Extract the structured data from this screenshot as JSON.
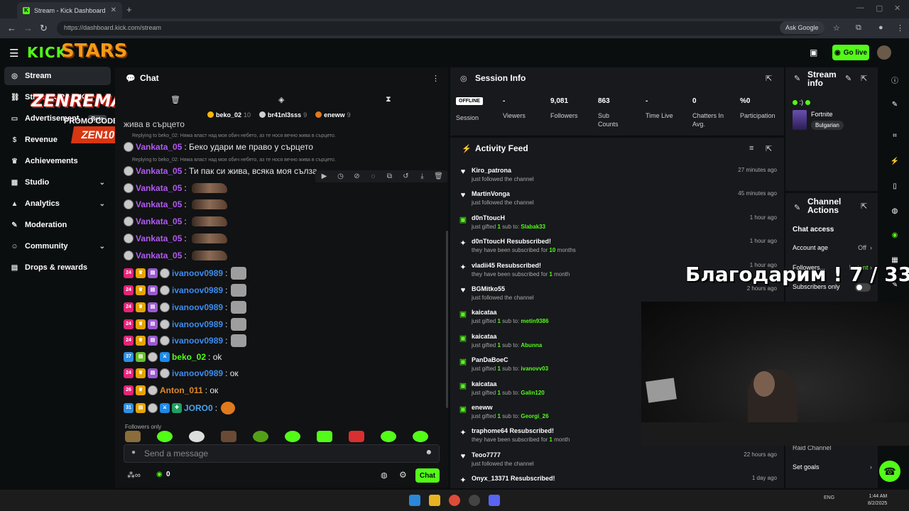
{
  "browser": {
    "tab_title": "Stream - Kick Dashboard",
    "url": "https://dashboard.kick.com/stream",
    "ask_google": "Ask Google"
  },
  "app": {
    "logo": "KICK",
    "overlay_brand": "STARS",
    "go_live": "Go live"
  },
  "overlay": {
    "streamer": "ZENREMASTA",
    "promo_label": "PROMO CODE",
    "promo_code": "ZEN10",
    "thanks_text": "Благодарим ! 7 / 33"
  },
  "sidebar": {
    "items": [
      {
        "label": "Stream",
        "icon": "broadcast-icon",
        "active": true
      },
      {
        "label": "Stream URL & Key",
        "icon": "link-icon"
      },
      {
        "label": "Advertisement",
        "icon": "ad-icon",
        "badge": "Beta"
      },
      {
        "label": "Revenue",
        "icon": "dollar-icon"
      },
      {
        "label": "Achievements",
        "icon": "trophy-icon"
      },
      {
        "label": "Studio",
        "icon": "studio-icon",
        "expandable": true
      },
      {
        "label": "Analytics",
        "icon": "analytics-icon",
        "expandable": true
      },
      {
        "label": "Moderation",
        "icon": "wrench-icon"
      },
      {
        "label": "Community",
        "icon": "community-icon",
        "expandable": true
      },
      {
        "label": "Drops & rewards",
        "icon": "drops-icon"
      }
    ]
  },
  "chat": {
    "title": "Chat",
    "pinned": [
      {
        "name": "beko_02",
        "count": "10",
        "color": "#f5b70b"
      },
      {
        "name": "br41nl3sss",
        "count": "9",
        "color": "#cfcfcf"
      },
      {
        "name": "eneww",
        "count": "9",
        "color": "#e07b1d"
      }
    ],
    "top_partial": "жива в сърцето",
    "reply1": "Replying to beko_02: Няма власт над моя обич небето, аз те нося вечно жива в сърцето.",
    "msg1_user": "Vankata_05",
    "msg1_text": ": Беко удари ме право у сърцето",
    "reply2": "Replying to beko_02: Няма власт над моя обич небето, аз те нося вечно жива в сърцето.",
    "msg2_user": "Vankata_05",
    "msg2_text": ": Ти пак си жива, всяка моя сълза",
    "vankata_user": "Vankata_05",
    "ivanoov_user": "ivanoov0989",
    "beko_user": "beko_02",
    "beko_text": ": ok",
    "ivanoov_ok_text": ": ок",
    "anton_user": "Anton_011",
    "anton_text": ": ок",
    "joro_user": "JORO0",
    "followers_only": "Followers only",
    "input_placeholder": "Send a message",
    "points": "0",
    "send_label": "Chat"
  },
  "session": {
    "title": "Session Info",
    "status": "OFFLINE",
    "status_label": "Session",
    "stats": [
      {
        "value": "-",
        "label": "Viewers"
      },
      {
        "value": "9,081",
        "label": "Followers"
      },
      {
        "value": "863",
        "label": "Sub Counts"
      },
      {
        "value": "-",
        "label": "Time Live"
      },
      {
        "value": "0",
        "label": "Chatters In Avg."
      },
      {
        "value": "%0",
        "label": "Participation"
      }
    ]
  },
  "activity": {
    "title": "Activity Feed",
    "items": [
      {
        "icon": "heart-icon",
        "name": "Kiro_patrona",
        "desc": "just followed the channel",
        "time": "27 minutes ago"
      },
      {
        "icon": "heart-icon",
        "name": "MartinVonga",
        "desc": "just followed the channel",
        "time": "45 minutes ago"
      },
      {
        "icon": "gift-icon",
        "name": "d0nTtoucH",
        "desc_pre": "just gifted ",
        "desc_num": "1",
        "desc_mid": " sub to: ",
        "desc_target": "Slabak33",
        "time": "1 hour ago"
      },
      {
        "icon": "sparkle-icon",
        "name": "d0nTtoucH Resubscribed!",
        "desc_pre": "they have been subscribed for ",
        "desc_num": "10",
        "desc_mid": " months",
        "desc_target": "",
        "time": "1 hour ago"
      },
      {
        "icon": "sparkle-icon",
        "name": "vladii45 Resubscribed!",
        "desc_pre": "they have been subscribed for ",
        "desc_num": "1",
        "desc_mid": " month",
        "desc_target": "",
        "time": "1 hour ago"
      },
      {
        "icon": "heart-icon",
        "name": "BGMitko55",
        "desc": "just followed the channel",
        "time": "2 hours ago"
      },
      {
        "icon": "gift-icon",
        "name": "kaicataa",
        "desc_pre": "just gifted ",
        "desc_num": "1",
        "desc_mid": " sub to: ",
        "desc_target": "metin9386",
        "time": ""
      },
      {
        "icon": "gift-icon",
        "name": "kaicataa",
        "desc_pre": "just gifted ",
        "desc_num": "1",
        "desc_mid": " sub to: ",
        "desc_target": "Abunna",
        "time": ""
      },
      {
        "icon": "gift-icon",
        "name": "PanDaBoeC",
        "desc_pre": "just gifted ",
        "desc_num": "1",
        "desc_mid": " sub to: ",
        "desc_target": "ivanovv03",
        "time": ""
      },
      {
        "icon": "gift-icon",
        "name": "kaicataa",
        "desc_pre": "just gifted ",
        "desc_num": "1",
        "desc_mid": " sub to: ",
        "desc_target": "Galin120",
        "time": ""
      },
      {
        "icon": "gift-icon",
        "name": "eneww",
        "desc_pre": "just gifted ",
        "desc_num": "1",
        "desc_mid": " sub to: ",
        "desc_target": "Georgi_26",
        "time": ""
      },
      {
        "icon": "sparkle-icon",
        "name": "traphome64 Resubscribed!",
        "desc_pre": "they have been subscribed for ",
        "desc_num": "1",
        "desc_mid": " month",
        "desc_target": "",
        "time": ""
      },
      {
        "icon": "heart-icon",
        "name": "Teoo7777",
        "desc": "just followed the channel",
        "time": "22 hours ago"
      },
      {
        "icon": "sparkle-icon",
        "name": "Onyx_13371 Resubscribed!",
        "desc": "",
        "time": "1 day ago"
      }
    ]
  },
  "stream_info": {
    "title": "Stream info",
    "status_text": ":)",
    "category": "Fortnite",
    "language": "Bulgarian"
  },
  "channel_actions": {
    "title": "Channel Actions",
    "chat_access": "Chat access",
    "account_age": "Account age",
    "account_age_value": "Off",
    "followers": "Followers...",
    "followers_value": "Instant",
    "subscribers_only": "Subscribers only",
    "raid_channel": "Raid Channel",
    "set_goals": "Set goals"
  },
  "taskbar": {
    "lang": "ENG",
    "time": "1:44 AM",
    "date": "8/2/2025"
  }
}
